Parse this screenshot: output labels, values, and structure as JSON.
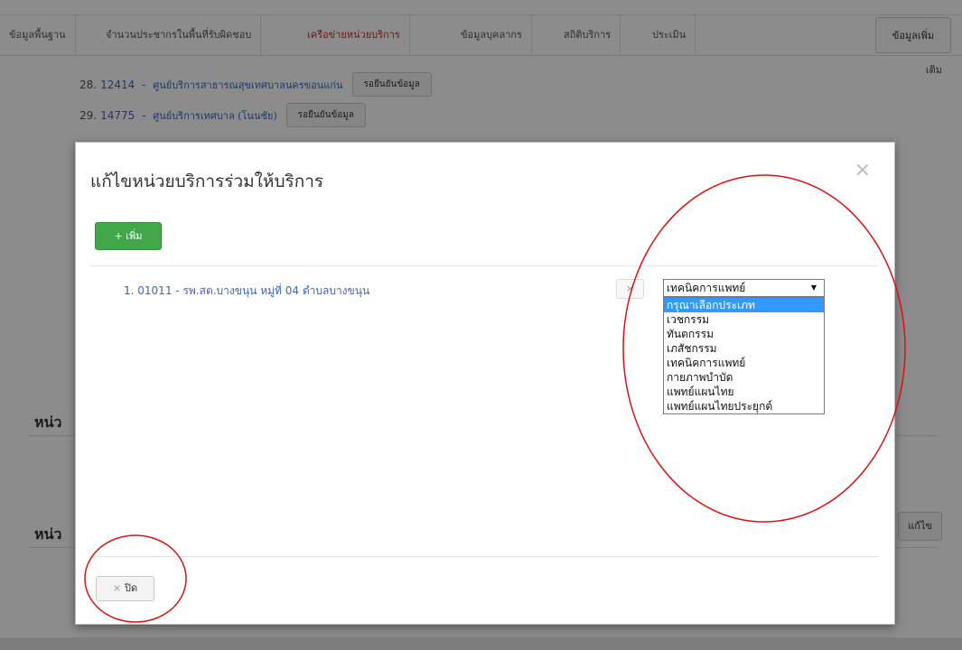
{
  "tabs": [
    {
      "label": "ข้อมูลพื้นฐาน",
      "active": false
    },
    {
      "label": "จำนวนประชากรในพื้นที่รับผิดชอบ",
      "active": false
    },
    {
      "label": "เครือข่ายหน่วยบริการ",
      "active": true
    },
    {
      "label": "ข้อมูลบุคลากร",
      "active": false
    },
    {
      "label": "สถิติบริการ",
      "active": false
    },
    {
      "label": "ประเมิน",
      "active": false
    }
  ],
  "extra_tab": {
    "line1": "ข้อมูลเพิ่ม",
    "line2": "เติม"
  },
  "background_list": [
    {
      "index": "28.",
      "code": "12414",
      "name": "ศูนย์บริการสาธารณสุขเทศบาลนครขอนแก่น",
      "status_button": "รอยืนยันข้อมูล"
    },
    {
      "index": "29.",
      "code": "14775",
      "name": "ศูนย์บริการเทศบาล (โนนชัย)",
      "status_button": "รอยืนยันข้อมูล"
    }
  ],
  "background_sections": [
    {
      "heading": "หน่ว"
    },
    {
      "heading": "หน่ว"
    }
  ],
  "background_edit_button": "แก้ไข",
  "modal": {
    "title": "แก้ไขหน่วยบริการร่วมให้บริการ",
    "close_symbol": "×",
    "add_button": "+ เพิ่ม",
    "items": [
      {
        "index": "1.",
        "code": "01011",
        "name": "รพ.สต.บางขนุน หมู่ที่ 04 ตำบลบางขนุน",
        "remove_symbol": "×",
        "selected_type": "เทคนิคการแพทย์",
        "type_options": [
          {
            "label": "กรุณาเลือกประเภท",
            "highlighted": true
          },
          {
            "label": "เวชกรรม",
            "highlighted": false
          },
          {
            "label": "ทันตกรรม",
            "highlighted": false
          },
          {
            "label": "เภสัชกรรม",
            "highlighted": false
          },
          {
            "label": "เทคนิคการแพทย์",
            "highlighted": false
          },
          {
            "label": "กายภาพบำบัด",
            "highlighted": false
          },
          {
            "label": "แพทย์แผนไทย",
            "highlighted": false
          },
          {
            "label": "แพทย์แผนไทยประยุกต์",
            "highlighted": false
          }
        ]
      }
    ],
    "footer_close_symbol": "×",
    "footer_close_label": "ปิด"
  },
  "colors": {
    "active_tab": "#d9272e",
    "link": "#3a66c4",
    "add_button": "#41a84a",
    "highlight_option": "#3399ff",
    "annotation": "#e01010"
  }
}
